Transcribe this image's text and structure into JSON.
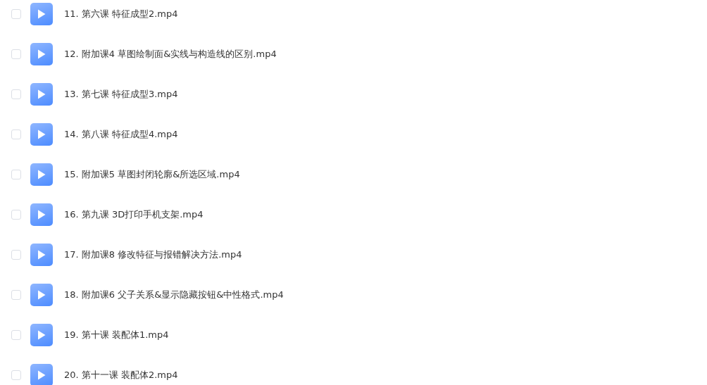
{
  "files": [
    {
      "name": "11. 第六课 特征成型2.mp4",
      "checked": false
    },
    {
      "name": "12. 附加课4 草图绘制面&实线与构造线的区别.mp4",
      "checked": false
    },
    {
      "name": "13. 第七课 特征成型3.mp4",
      "checked": false
    },
    {
      "name": "14. 第八课 特征成型4.mp4",
      "checked": false
    },
    {
      "name": "15. 附加课5 草图封闭轮廓&所选区域.mp4",
      "checked": false
    },
    {
      "name": "16. 第九课 3D打印手机支架.mp4",
      "checked": false
    },
    {
      "name": "17. 附加课8 修改特征与报错解决方法.mp4",
      "checked": false
    },
    {
      "name": "18. 附加课6 父子关系&显示隐藏按钮&中性格式.mp4",
      "checked": false
    },
    {
      "name": "19. 第十课 装配体1.mp4",
      "checked": false
    },
    {
      "name": "20. 第十一课 装配体2.mp4",
      "checked": false
    }
  ]
}
